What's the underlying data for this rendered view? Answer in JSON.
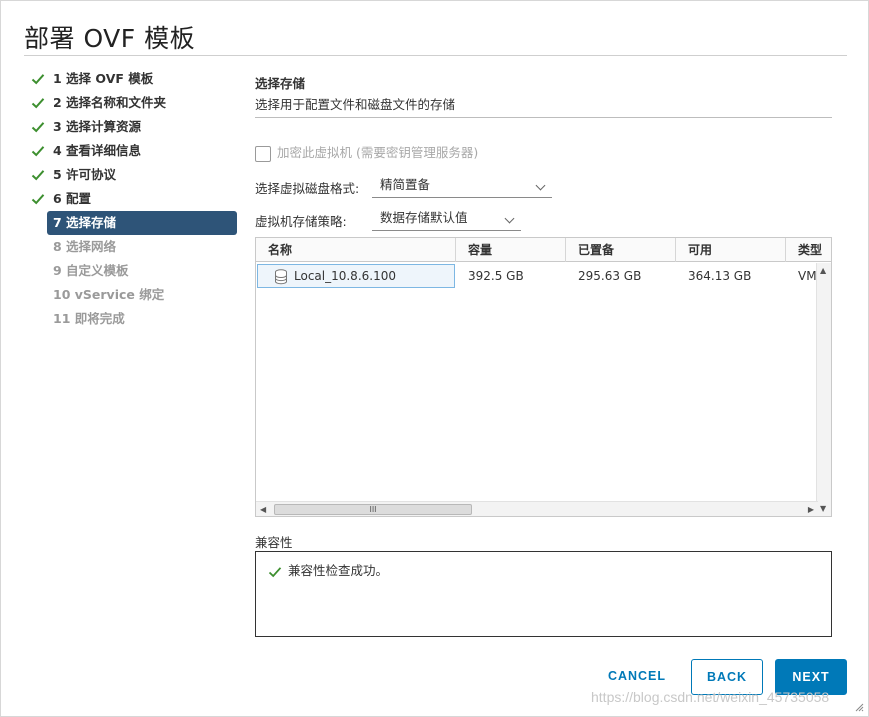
{
  "dialog": {
    "title": "部署 OVF 模板"
  },
  "steps": [
    {
      "label": "1 选择 OVF 模板",
      "state": "done"
    },
    {
      "label": "2 选择名称和文件夹",
      "state": "done"
    },
    {
      "label": "3 选择计算资源",
      "state": "done"
    },
    {
      "label": "4 查看详细信息",
      "state": "done"
    },
    {
      "label": "5 许可协议",
      "state": "done"
    },
    {
      "label": "6 配置",
      "state": "done"
    },
    {
      "label": "7 选择存储",
      "state": "active"
    },
    {
      "label": "8 选择网络",
      "state": "pending"
    },
    {
      "label": "9 自定义模板",
      "state": "pending"
    },
    {
      "label": "10 vService 绑定",
      "state": "pending"
    },
    {
      "label": "11 即将完成",
      "state": "pending"
    }
  ],
  "main": {
    "section_title": "选择存储",
    "section_desc": "选择用于配置文件和磁盘文件的存储",
    "encrypt_label": "加密此虚拟机 (需要密钥管理服务器)",
    "disk_format_label": "选择虚拟磁盘格式:",
    "disk_format_value": "精简置备",
    "storage_policy_label": "虚拟机存储策略:",
    "storage_policy_value": "数据存储默认值"
  },
  "grid": {
    "columns": [
      "名称",
      "容量",
      "已置备",
      "可用",
      "类型"
    ],
    "rows": [
      {
        "name": "Local_10.8.6.100",
        "capacity": "392.5 GB",
        "provisioned": "295.63 GB",
        "free": "364.13 GB",
        "type": "VM"
      }
    ],
    "hscroll_thumb": "III"
  },
  "compatibility": {
    "label": "兼容性",
    "message": "兼容性检查成功。"
  },
  "footer": {
    "cancel": "CANCEL",
    "back": "BACK",
    "next": "NEXT"
  },
  "watermark": "https://blog.csdn.net/weixin_45735058",
  "colors": {
    "accent": "#0079b8",
    "active_step": "#2e5478",
    "check": "#3d8f2f"
  }
}
